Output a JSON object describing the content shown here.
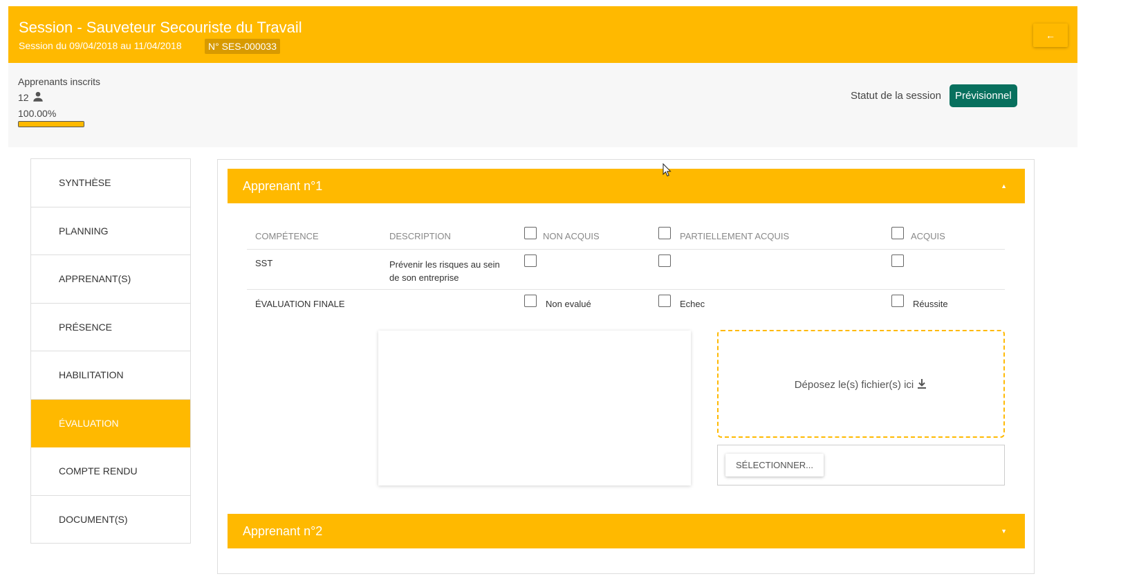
{
  "header": {
    "title": "Session - Sauveteur Secouriste du Travail",
    "subtitle": "Session du 09/04/2018 au 11/04/2018",
    "reference": "N° SES-000033",
    "back_icon": "←"
  },
  "info": {
    "enrolled_label": "Apprenants inscrits",
    "enrolled_count": "12",
    "progress_text": "100.00%",
    "progress_value": 100,
    "status_label": "Statut de la session",
    "status_value": "Prévisionnel"
  },
  "sidebar": {
    "items": [
      {
        "label": "SYNTHÈSE"
      },
      {
        "label": "PLANNING"
      },
      {
        "label": "APPRENANT(S)"
      },
      {
        "label": "PRÉSENCE"
      },
      {
        "label": "HABILITATION"
      },
      {
        "label": "ÉVALUATION"
      },
      {
        "label": "COMPTE RENDU"
      },
      {
        "label": "DOCUMENT(S)"
      }
    ]
  },
  "learners": [
    {
      "title": "Apprenant n°1",
      "caret": "▲"
    },
    {
      "title": "Apprenant n°2",
      "caret": "▼"
    }
  ],
  "evaluation_table": {
    "headers": {
      "competence": "COMPÉTENCE",
      "description": "DESCRIPTION",
      "non_acquis": "NON ACQUIS",
      "partiel": "PARTIELLEMENT ACQUIS",
      "acquis": "ACQUIS"
    },
    "skill_row": {
      "name": "SST",
      "description_line1": "Prévenir les risques au sein",
      "description_line2": "de son entreprise"
    },
    "final_row": {
      "name": "ÉVALUATION FINALE",
      "opt1": "Non evalué",
      "opt2": "Echec",
      "opt3": "Réussite"
    }
  },
  "upload": {
    "drop_text": "Déposez le(s) fichier(s) ici",
    "select_label": "SÉLECTIONNER..."
  },
  "colors": {
    "accent": "#FFB900",
    "badge_dark": "#D89A00",
    "status": "#08705E"
  }
}
